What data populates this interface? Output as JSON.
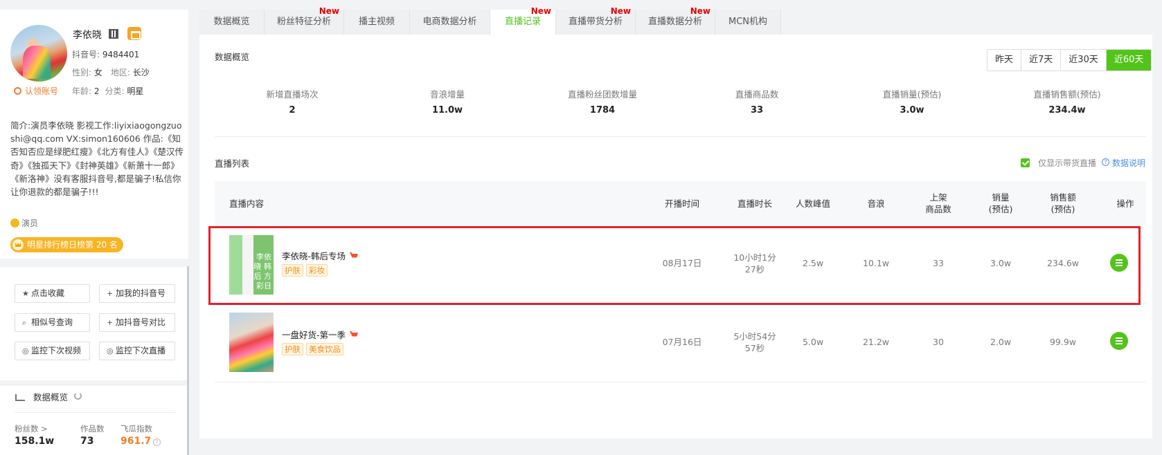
{
  "profile": {
    "name": "李依晓",
    "douyin_id_label": "抖音号:",
    "douyin_id": "9484401",
    "gender_label": "性别:",
    "gender": "女",
    "region_label": "地区:",
    "region": "长沙",
    "claim_label": "认领账号",
    "age_label": "年龄:",
    "age": "2",
    "category_label": "分类:",
    "category": "明星",
    "bio": "简介:演员李依晓 影视工作:liyixiaogongzuoshi@qq.com VX:simon160606 作品:《知否知否应是绿肥红瘦》《北方有佳人》《楚汉传奇》《独孤天下》《封神英雄》《新萧十一郎》《新洛神》没有客服抖音号,都是骗子!私信你让你退款的都是骗子!!!",
    "tag": "演员",
    "rank_badge": "明星排行榜日榜第 20 名"
  },
  "actions": {
    "favorite": "点击收藏",
    "add_mine": "加我的抖音号",
    "similar": "相似号查询",
    "compare": "加抖音号对比",
    "monitor_video": "监控下次视频",
    "monitor_live": "监控下次直播"
  },
  "overview": {
    "title": "数据概览",
    "fans_label": "粉丝数 >",
    "fans": "158.1w",
    "works_label": "作品数",
    "works": "73",
    "index_label": "飞瓜指数",
    "index": "961.7"
  },
  "tabs": [
    {
      "label": "数据概览",
      "new": ""
    },
    {
      "label": "粉丝特征分析",
      "new": "New"
    },
    {
      "label": "播主视频",
      "new": ""
    },
    {
      "label": "电商数据分析",
      "new": ""
    },
    {
      "label": "直播记录",
      "new": "New"
    },
    {
      "label": "直播带货分析",
      "new": "New"
    },
    {
      "label": "直播数据分析",
      "new": "New"
    },
    {
      "label": "MCN机构",
      "new": ""
    }
  ],
  "summary": {
    "title": "数据概览",
    "ranges": [
      "昨天",
      "近7天",
      "近30天",
      "近60天"
    ],
    "active_range": "近60天",
    "kpis": [
      {
        "label": "新增直播场次",
        "value": "2"
      },
      {
        "label": "音浪增量",
        "value": "11.0w"
      },
      {
        "label": "直播粉丝团数增量",
        "value": "1784"
      },
      {
        "label": "直播商品数",
        "value": "33"
      },
      {
        "label": "直播销量(预估)",
        "value": "3.0w"
      },
      {
        "label": "直播销售额(预估)",
        "value": "234.4w"
      }
    ]
  },
  "live_list": {
    "title": "直播列表",
    "only_label": "仅显示带货直播",
    "info_link": "数据说明",
    "columns": [
      "直播内容",
      "开播时间",
      "直播时长",
      "人数峰值",
      "音浪",
      "上架\n商品数",
      "销量\n(预估)",
      "销售额\n(预估)",
      "操作"
    ],
    "rows": [
      {
        "title": "李依晓-韩后专场",
        "tags": [
          "护肤",
          "彩妆"
        ],
        "thumb_text": "李依晓 韩后 方彩日",
        "start": "08月17日",
        "duration": "10小时1分\n27秒",
        "peak": "2.5w",
        "yinlang": "10.1w",
        "goods": "33",
        "sales": "3.0w",
        "revenue": "234.6w"
      },
      {
        "title": "一盘好货-第一季",
        "tags": [
          "护肤",
          "美食饮品"
        ],
        "thumb_text": "",
        "start": "07月16日",
        "duration": "5小时54分\n57秒",
        "peak": "5.0w",
        "yinlang": "21.2w",
        "goods": "30",
        "sales": "2.0w",
        "revenue": "99.9w"
      }
    ]
  },
  "colors": {
    "accent": "#52c41a",
    "new_badge": "#e30000",
    "highlight": "#e3212a",
    "orange": "#f57c1f",
    "badge": "#f9b423"
  }
}
